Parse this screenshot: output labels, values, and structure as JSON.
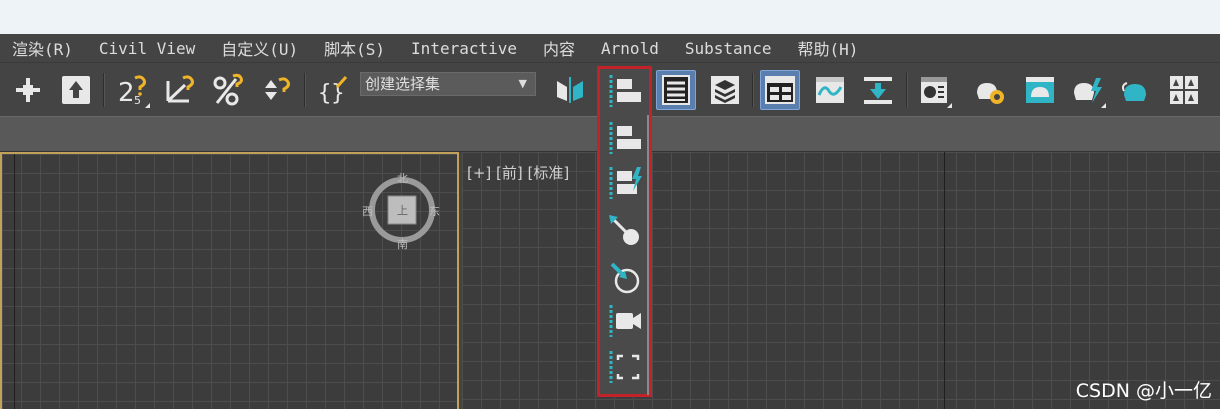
{
  "menu": [
    "渲染(R)",
    "Civil View",
    "自定义(U)",
    "脚本(S)",
    "Interactive",
    "内容",
    "Arnold",
    "Substance",
    "帮助(H)"
  ],
  "selection_set": {
    "value": "创建选择集",
    "arrow": "▼"
  },
  "toolbar_labels": {
    "snap_25": "2",
    "snap_25_sub": "5"
  },
  "viewport": {
    "label": "[+] [前] [标准]"
  },
  "viewcube": {
    "north": "北",
    "south": "南",
    "west": "西",
    "east": "东",
    "center": "上"
  },
  "watermark": "CSDN @小一亿",
  "colors": {
    "accent": "#2fb5c5",
    "highlight": "#c3222a",
    "active_btn": "#5a7fae",
    "viewport_border": "#c2a25a"
  },
  "icons": {
    "toolbar": [
      "move-pivot-icon",
      "select-and-link-icon",
      "snap-toggle-icon",
      "angle-snap-icon",
      "percent-snap-icon",
      "spinner-snap-icon",
      "edit-named-selection-icon",
      "mirror-icon",
      "align-icon",
      "scene-explorer-icon",
      "layer-explorer-icon",
      "ribbon-toggle-icon",
      "curve-editor-icon",
      "schematic-view-icon",
      "material-editor-icon",
      "render-setup-icon",
      "rendered-frame-icon",
      "render-icon",
      "render-iterative-icon",
      "render-online-icon",
      "render-grid-icon"
    ],
    "flyout": [
      "align-icon",
      "quick-align-icon",
      "normal-align-icon",
      "place-highlight-icon",
      "align-camera-icon",
      "align-to-view-icon"
    ]
  }
}
